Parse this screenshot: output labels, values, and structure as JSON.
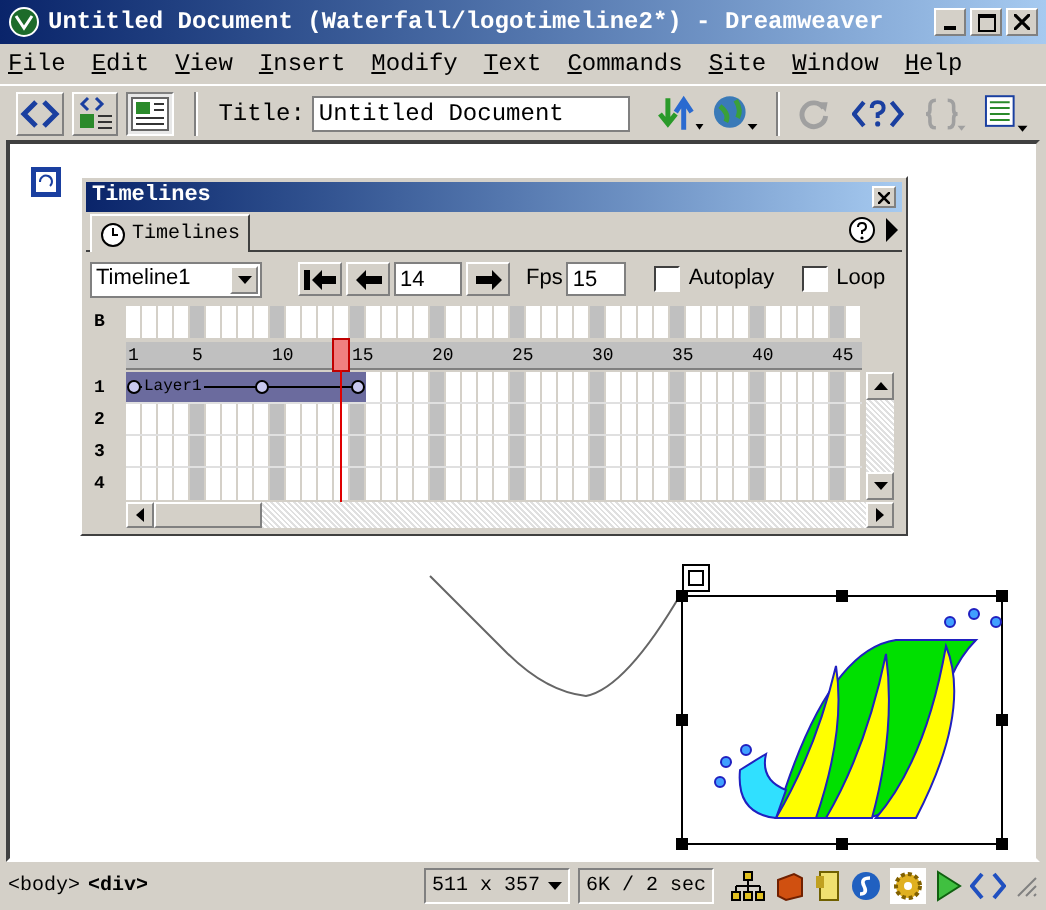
{
  "window": {
    "title": "Untitled Document (Waterfall/logotimeline2*) - Dreamweaver"
  },
  "menu": [
    "File",
    "Edit",
    "View",
    "Insert",
    "Modify",
    "Text",
    "Commands",
    "Site",
    "Window",
    "Help"
  ],
  "toolbar": {
    "views": [
      {
        "kind": "code",
        "selected": false
      },
      {
        "kind": "split",
        "selected": false
      },
      {
        "kind": "design",
        "selected": true
      }
    ],
    "title_label": "Title:",
    "title_value": "Untitled Document"
  },
  "timelines": {
    "title": "Timelines",
    "tab": "Timelines",
    "timeline": "Timeline1",
    "frame": "14",
    "fps_label": "Fps",
    "fps": "15",
    "options": [
      {
        "label": "Autoplay",
        "checked": false
      },
      {
        "label": "Loop",
        "checked": false
      }
    ],
    "ruler": [
      "1",
      "5",
      "10",
      "15",
      "20",
      "25",
      "30",
      "35",
      "40",
      "45"
    ],
    "channels": [
      "B",
      "1",
      "2",
      "3",
      "4"
    ],
    "layer": "Layer1"
  },
  "status_bar": {
    "tags": [
      "<body>",
      "<div>"
    ],
    "window_size": "511 x 357",
    "download": "6K / 2 sec"
  }
}
